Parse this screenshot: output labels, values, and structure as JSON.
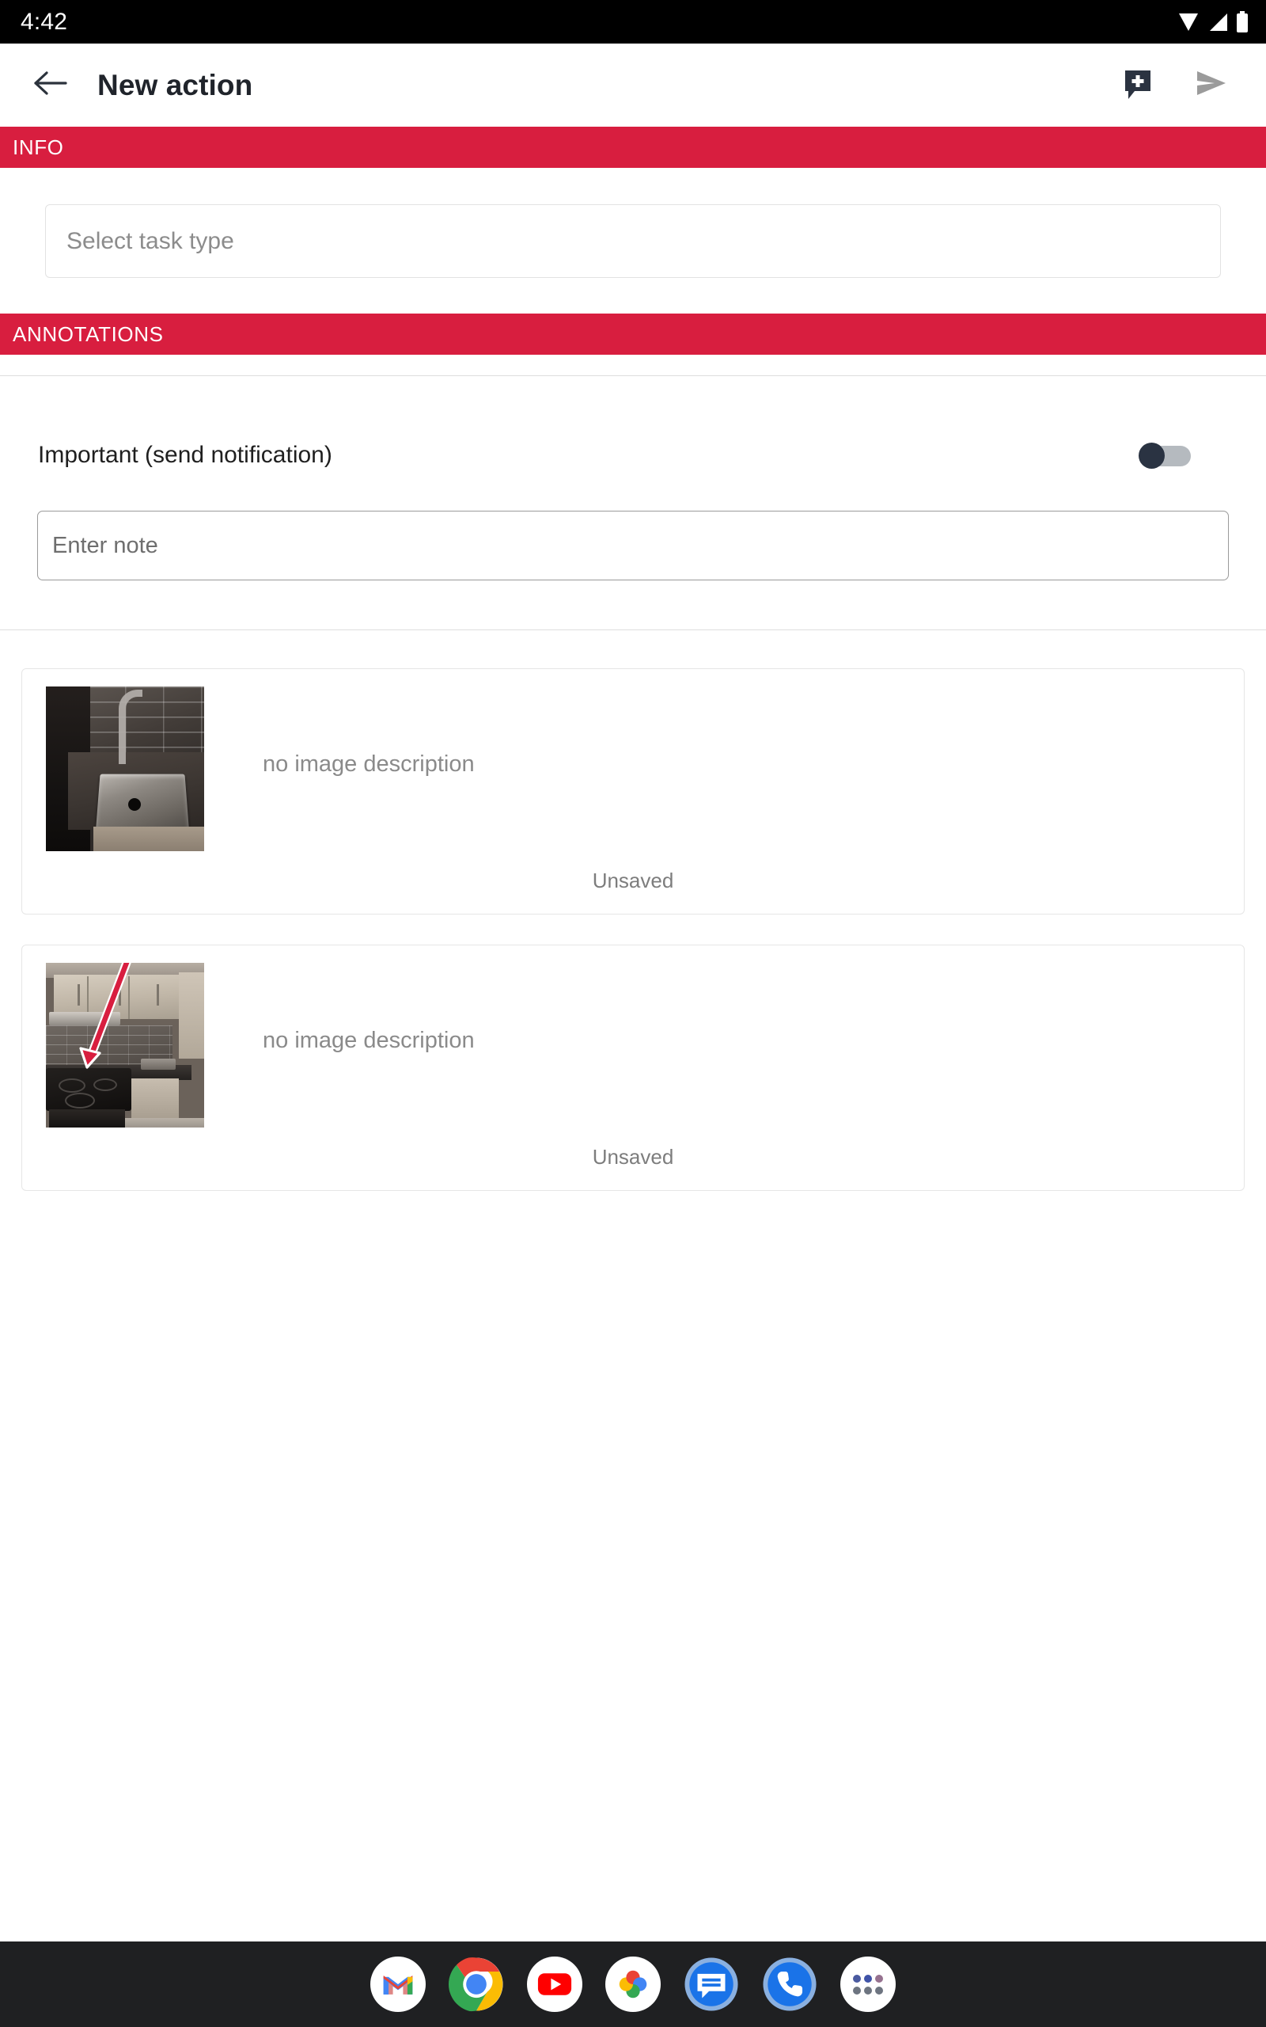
{
  "status_bar": {
    "time": "4:42",
    "icons": [
      "wifi-icon",
      "signal-icon",
      "battery-icon"
    ]
  },
  "app_bar": {
    "back_icon": "back-arrow-icon",
    "title": "New action",
    "actions": [
      {
        "name": "add-comment-icon",
        "label": "Add comment"
      },
      {
        "name": "send-icon",
        "label": "Send"
      }
    ]
  },
  "colors": {
    "section_header_bg": "#d81e3f",
    "section_header_text": "#ffffff",
    "toggle_thumb": "#2a3342",
    "toggle_track": "#b5babf",
    "annotation_arrow": "#d81e3f",
    "dock_bg": "#1f2022"
  },
  "sections": {
    "info": {
      "header": "INFO",
      "task_type_field": {
        "placeholder": "Select task type",
        "value": ""
      }
    },
    "annotations": {
      "header": "ANNOTATIONS",
      "important_toggle": {
        "label": "Important (send notification)",
        "state": "off"
      },
      "note_field": {
        "placeholder": "Enter note",
        "value": ""
      }
    }
  },
  "attachments": [
    {
      "thumbnail": "kitchen-sink-photo",
      "description": "no image description",
      "status": "Unsaved"
    },
    {
      "thumbnail": "kitchen-stove-photo-with-red-arrow-annotation",
      "description": "no image description",
      "status": "Unsaved"
    }
  ],
  "dock": {
    "items": [
      {
        "name": "gmail-icon",
        "label": "Gmail"
      },
      {
        "name": "chrome-icon",
        "label": "Chrome"
      },
      {
        "name": "youtube-icon",
        "label": "YouTube"
      },
      {
        "name": "google-photos-icon",
        "label": "Photos"
      },
      {
        "name": "messages-icon",
        "label": "Messages"
      },
      {
        "name": "phone-icon",
        "label": "Phone"
      },
      {
        "name": "app-drawer-icon",
        "label": "All apps"
      }
    ]
  }
}
